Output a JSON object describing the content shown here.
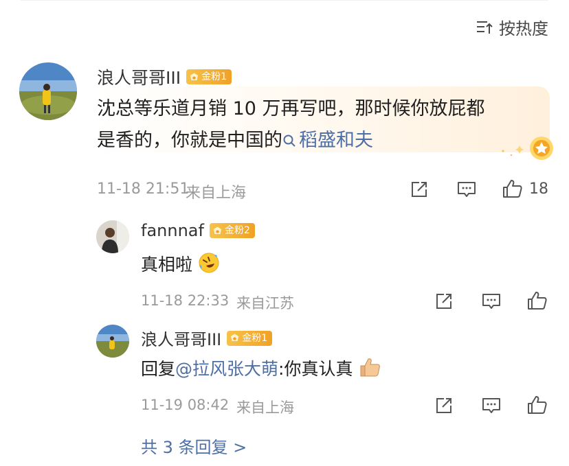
{
  "sort": {
    "label": "按热度"
  },
  "comment": {
    "username": "浪人哥哥III",
    "badge": "金粉1",
    "text_line1": "沈总等乐道月销 10 万再写吧，那时候你放屁都",
    "text_line2_prefix": "是香的，你就是中国的",
    "hashtag": "稻盛和夫",
    "time": "11-18 21:51",
    "location": "来自上海",
    "likes": "18"
  },
  "replies": [
    {
      "username": "fannnaf",
      "badge": "金粉2",
      "text": "真相啦",
      "time": "11-18 22:33",
      "location": "来自江苏"
    },
    {
      "username": "浪人哥哥III",
      "badge": "金粉1",
      "text_prefix": "回复",
      "mention": "@拉风张大萌",
      "text_suffix": ":你真认真",
      "time": "11-19 08:42",
      "location": "来自上海"
    }
  ],
  "more_replies": "共 3 条回复 >",
  "colors": {
    "link": "#4d6fa6",
    "badge": "#f0a126",
    "meta": "#9a9a9a"
  }
}
